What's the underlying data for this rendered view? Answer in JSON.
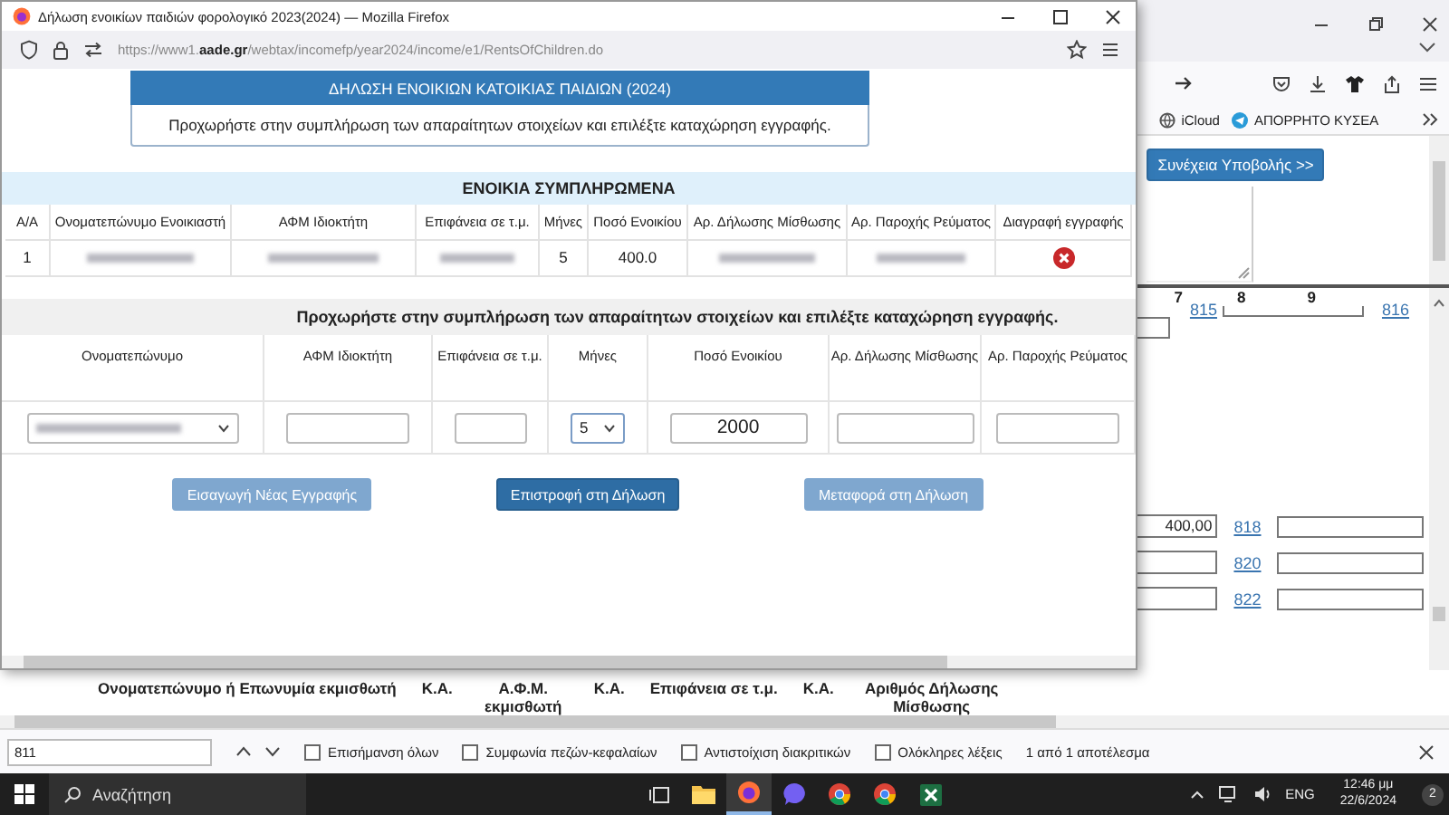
{
  "popup": {
    "title": "Δήλωση ενοικίων παιδιών φορολογικό 2023(2024) — Mozilla Firefox",
    "url": "https://www1.**aade.gr**/webtax/incomefp/year2024/income/e1/RentsOfChildren.do",
    "heading": "ΔΗΛΩΣΗ ΕΝΟΙΚΙΩΝ ΚΑΤΟΙΚΙΑΣ ΠΑΙΔΙΩΝ (2024)",
    "intro": "Προχωρήστε στην συμπλήρωση των απαραίτητων στοιχείων και επιλέξτε καταχώρηση εγγραφής.",
    "completed": {
      "title": "ΕΝΟΙΚΙΑ ΣΥΜΠΛΗΡΩΜΕΝΑ",
      "columns": [
        "Α/Α",
        "Ονοματεπώνυμο Ενοικιαστή",
        "ΑΦΜ Ιδιοκτήτη",
        "Επιφάνεια σε τ.μ.",
        "Μήνες",
        "Ποσό Ενοικίου",
        "Αρ. Δήλωσης Μίσθωσης",
        "Αρ. Παροχής Ρεύματος",
        "Διαγραφή εγγραφής"
      ],
      "rows": [
        {
          "cells": [
            {
              "kind": "text",
              "text": "1"
            },
            {
              "kind": "redacted"
            },
            {
              "kind": "redacted"
            },
            {
              "kind": "redacted"
            },
            {
              "kind": "text",
              "text": "5"
            },
            {
              "kind": "text",
              "text": "400.0"
            },
            {
              "kind": "redacted"
            },
            {
              "kind": "redacted"
            },
            {
              "kind": "delete"
            }
          ]
        }
      ]
    },
    "form": {
      "instruction": "Προχωρήστε στην συμπλήρωση των απαραίτητων στοιχείων και επιλέξτε καταχώρηση εγγραφής.",
      "columns": [
        "Ονοματεπώνυμο",
        "ΑΦΜ Ιδιοκτήτη",
        "Επιφάνεια σε τ.μ.",
        "Μήνες",
        "Ποσό Ενοικίου",
        "Αρ. Δήλωσης Μίσθωσης",
        "Αρ. Παροχής Ρεύματος"
      ],
      "fields": [
        {
          "kind": "select",
          "redacted": true
        },
        {
          "kind": "input"
        },
        {
          "kind": "input"
        },
        {
          "kind": "select",
          "value": "5"
        },
        {
          "kind": "input",
          "value": "2000"
        },
        {
          "kind": "input"
        },
        {
          "kind": "input"
        }
      ]
    },
    "buttons": [
      {
        "label": "Εισαγωγή Νέας Εγγραφής",
        "disabled": true
      },
      {
        "label": "Επιστροφή στη Δήλωση",
        "disabled": false
      },
      {
        "label": "Μεταφορά στη Δήλωση",
        "disabled": true
      }
    ]
  },
  "browser": {
    "bookmarks": [
      {
        "kind": "globe",
        "label": "iCloud"
      },
      {
        "kind": "telegram",
        "label": "ΑΠΟΡΡΗΤΟ ΚΥΣΕΑ"
      }
    ]
  },
  "page": {
    "submit_button": "Συνέχεια Υποβολής >>",
    "column_numbers": [
      "7",
      "8",
      "9"
    ],
    "links": [
      "815",
      "816"
    ],
    "fields": [
      {
        "value": "400,00",
        "code": "818"
      },
      {
        "code": "820"
      },
      {
        "code": "822"
      }
    ],
    "table_headers": [
      "Ονοματεπώνυμο ή Επωνυμία εκμισθωτή",
      "Κ.Α.",
      "Α.Φ.Μ. εκμισθωτή",
      "Κ.Α.",
      "Επιφάνεια σε τ.μ.",
      "Κ.Α.",
      "Αριθμός Δήλωσης Μίσθωσης"
    ]
  },
  "find_bar": {
    "query": "811",
    "options": [
      {
        "label": "Επισήμανση όλων",
        "checked": false
      },
      {
        "label": "Συμφωνία πεζών-κεφαλαίων",
        "checked": false
      },
      {
        "label": "Αντιστοίχιση διακριτικών",
        "checked": false
      },
      {
        "label": "Ολόκληρες λέξεις",
        "checked": false
      }
    ],
    "result": "1 από 1 αποτέλεσμα"
  },
  "taskbar": {
    "search_placeholder": "Αναζήτηση",
    "apps": [
      {
        "kind": "task-view",
        "active": false
      },
      {
        "kind": "folder",
        "active": false
      },
      {
        "kind": "firefox",
        "active": true
      },
      {
        "kind": "viber",
        "active": false
      },
      {
        "kind": "chrome",
        "active": false
      },
      {
        "kind": "chrome",
        "active": false
      },
      {
        "kind": "excel",
        "active": false
      }
    ],
    "language": "ENG",
    "time": "12:46 μμ",
    "date": "22/6/2024",
    "notifications": "2"
  }
}
